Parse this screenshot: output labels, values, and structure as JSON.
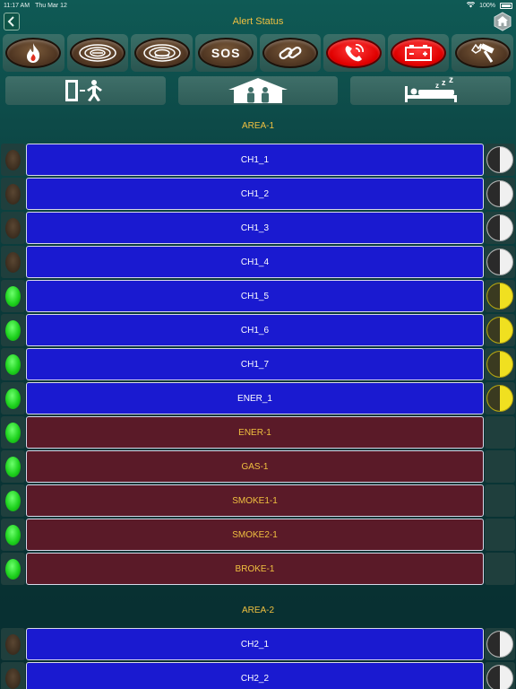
{
  "status_bar": {
    "time": "11:17 AM",
    "date": "Thu Mar 12",
    "battery": "100%"
  },
  "nav": {
    "title": "Alert Status",
    "back_icon": "chevron-left-icon",
    "home_icon": "home-icon"
  },
  "sensor_icons": [
    {
      "name": "fire-icon",
      "style": "brown"
    },
    {
      "name": "smoke-detector-icon",
      "style": "brown"
    },
    {
      "name": "smoke-detector-2-icon",
      "style": "brown"
    },
    {
      "name": "sos-icon",
      "style": "brown",
      "label": "SOS"
    },
    {
      "name": "link-icon",
      "style": "brown"
    },
    {
      "name": "phone-icon",
      "style": "red"
    },
    {
      "name": "battery-icon",
      "style": "red"
    },
    {
      "name": "hammer-break-icon",
      "style": "brown"
    }
  ],
  "modes": [
    {
      "name": "away-mode-icon"
    },
    {
      "name": "home-mode-icon"
    },
    {
      "name": "sleep-mode-icon"
    }
  ],
  "areas": [
    {
      "label": "AREA-1",
      "channels": [
        {
          "label": "CH1_1",
          "led": "off",
          "color": "blue",
          "toggle": "off"
        },
        {
          "label": "CH1_2",
          "led": "off",
          "color": "blue",
          "toggle": "off"
        },
        {
          "label": "CH1_3",
          "led": "off",
          "color": "blue",
          "toggle": "off"
        },
        {
          "label": "CH1_4",
          "led": "off",
          "color": "blue",
          "toggle": "off"
        },
        {
          "label": "CH1_5",
          "led": "on",
          "color": "blue",
          "toggle": "on"
        },
        {
          "label": "CH1_6",
          "led": "on",
          "color": "blue",
          "toggle": "on"
        },
        {
          "label": "CH1_7",
          "led": "on",
          "color": "blue",
          "toggle": "on"
        },
        {
          "label": "ENER_1",
          "led": "on",
          "color": "blue",
          "toggle": "on"
        },
        {
          "label": "ENER-1",
          "led": "on",
          "color": "maroon",
          "toggle": "none"
        },
        {
          "label": "GAS-1",
          "led": "on",
          "color": "maroon",
          "toggle": "none"
        },
        {
          "label": "SMOKE1-1",
          "led": "on",
          "color": "maroon",
          "toggle": "none"
        },
        {
          "label": "SMOKE2-1",
          "led": "on",
          "color": "maroon",
          "toggle": "none"
        },
        {
          "label": "BROKE-1",
          "led": "on",
          "color": "maroon",
          "toggle": "none"
        }
      ]
    },
    {
      "label": "AREA-2",
      "channels": [
        {
          "label": "CH2_1",
          "led": "off",
          "color": "blue",
          "toggle": "off"
        },
        {
          "label": "CH2_2",
          "led": "off",
          "color": "blue",
          "toggle": "off"
        }
      ]
    }
  ],
  "colors": {
    "accent": "#f0c040",
    "blue_button": "#1a1ad0",
    "maroon_button": "#5a1a28",
    "led_on": "#1ed21e",
    "toggle_on": "#f0e020"
  }
}
